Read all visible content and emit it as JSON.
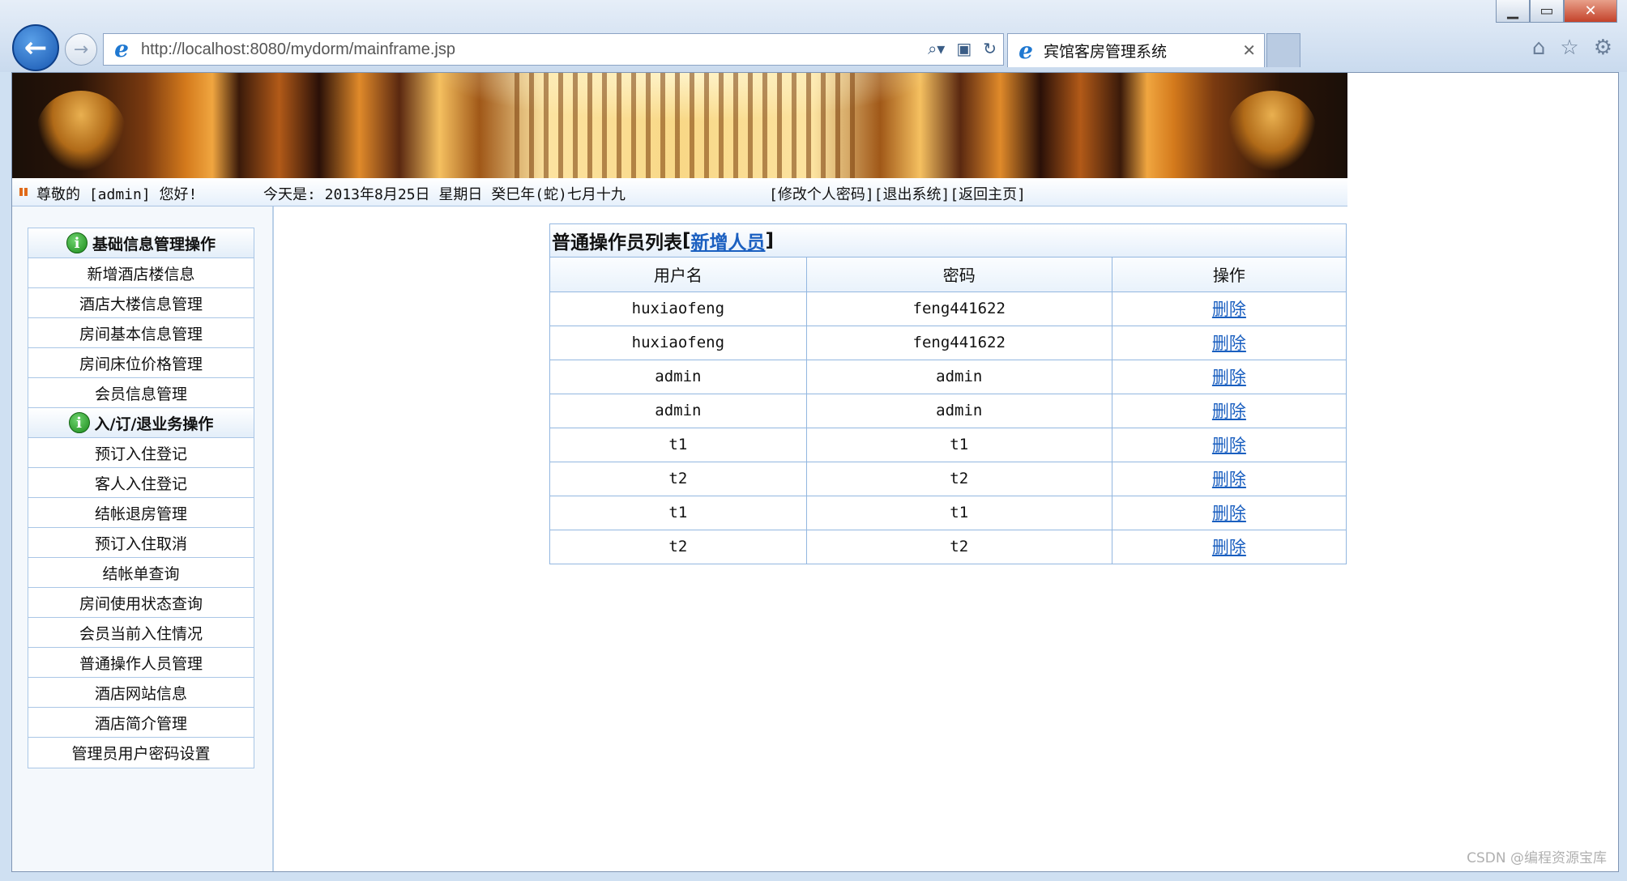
{
  "browser": {
    "url": "http://localhost:8080/mydorm/mainframe.jsp",
    "tab_title": "宾馆客房管理系统",
    "tab_close": "✕",
    "window_buttons": {
      "minimize": "▁",
      "maximize": "▭",
      "close": "✕"
    }
  },
  "infobar": {
    "greeting": "尊敬的 [admin] 您好!",
    "date": "今天是: 2013年8月25日 星期日 癸巳年(蛇)七月十九",
    "links": "[修改个人密码][退出系统][返回主页]"
  },
  "sidebar": {
    "section1_title": "基础信息管理操作",
    "section1_items": [
      "新增酒店楼信息",
      "酒店大楼信息管理",
      "房间基本信息管理",
      "房间床位价格管理",
      "会员信息管理"
    ],
    "section2_title": "入/订/退业务操作",
    "section2_items": [
      "预订入住登记",
      "客人入住登记",
      "结帐退房管理",
      "预订入住取消",
      "结帐单查询",
      "房间使用状态查询",
      "会员当前入住情况",
      "普通操作人员管理",
      "酒店网站信息",
      "酒店简介管理",
      "管理员用户密码设置"
    ]
  },
  "main": {
    "title": "普通操作员列表",
    "add_link": "新增人员",
    "bracket_open": "[",
    "bracket_close": "]",
    "columns": [
      "用户名",
      "密码",
      "操作"
    ],
    "rows": [
      {
        "username": "huxiaofeng",
        "password": "feng441622",
        "action": "删除"
      },
      {
        "username": "huxiaofeng",
        "password": "feng441622",
        "action": "删除"
      },
      {
        "username": "admin",
        "password": "admin",
        "action": "删除"
      },
      {
        "username": "admin",
        "password": "admin",
        "action": "删除"
      },
      {
        "username": "t1",
        "password": "t1",
        "action": "删除"
      },
      {
        "username": "t2",
        "password": "t2",
        "action": "删除"
      },
      {
        "username": "t1",
        "password": "t1",
        "action": "删除"
      },
      {
        "username": "t2",
        "password": "t2",
        "action": "删除"
      }
    ]
  },
  "watermark": "CSDN @编程资源宝库",
  "icons": {
    "back": "back-arrow-icon",
    "forward": "forward-arrow-icon",
    "ie": "ie-logo-icon",
    "search": "search-icon",
    "refresh": "refresh-icon",
    "home": "home-icon",
    "favorites": "star-icon",
    "settings": "gear-icon",
    "menu_section": "info-icon"
  },
  "colors": {
    "link": "#1a5fc0",
    "border": "#93b7e0",
    "accent": "#e06a1a"
  }
}
